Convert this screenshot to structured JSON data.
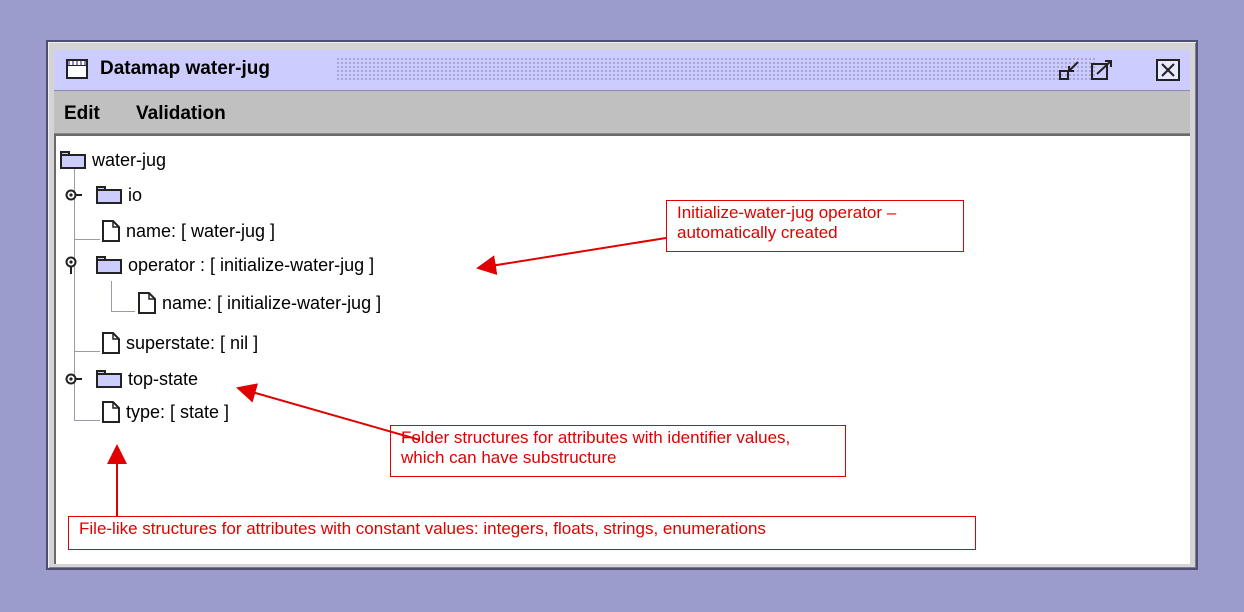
{
  "window": {
    "title": "Datamap water-jug",
    "minimize_glyph": "⧉",
    "maximize_glyph": "⤢",
    "close_glyph": "×"
  },
  "menu": {
    "items": [
      "Edit",
      "Validation"
    ]
  },
  "tree": {
    "root": "water-jug",
    "nodes": [
      {
        "kind": "folder",
        "label": "io",
        "expandable": true
      },
      {
        "kind": "file",
        "label": "name: [ water-jug ]"
      },
      {
        "kind": "folder",
        "label": "operator : [ initialize-water-jug ]",
        "expanded": true
      },
      {
        "kind": "file",
        "label": "name: [ initialize-water-jug ]"
      },
      {
        "kind": "file",
        "label": "superstate: [ nil ]"
      },
      {
        "kind": "folder",
        "label": "top-state",
        "expandable": true
      },
      {
        "kind": "file",
        "label": "type: [ state ]"
      }
    ]
  },
  "annotations": {
    "operator_note": "Initialize-water-jug operator – automatically created",
    "folder_note": "Folder structures for attributes with identifier values, which can have substructure",
    "file_note": "File-like structures for attributes with constant values: integers, floats, strings, enumerations",
    "color": "#e00000"
  },
  "colors": {
    "desktop": "#9c9ccc",
    "titlebar": "#ccccff",
    "menubar": "#c0c0c0",
    "tree_background": "#ffffff"
  }
}
